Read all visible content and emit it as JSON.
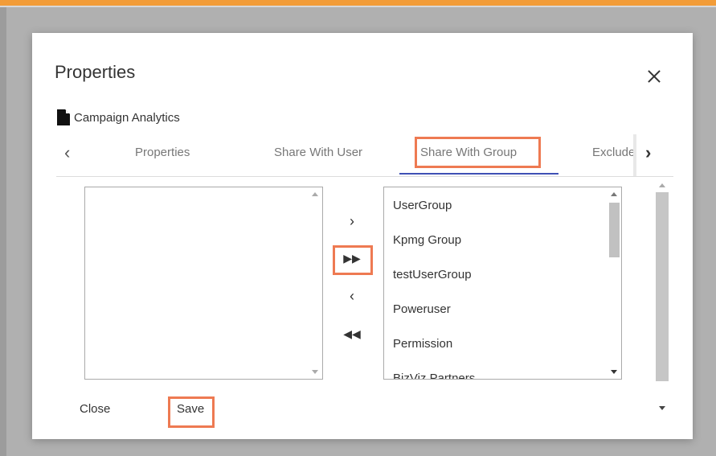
{
  "dialog": {
    "title": "Properties",
    "file_name": "Campaign Analytics"
  },
  "tabs": {
    "items": [
      {
        "label": "Properties"
      },
      {
        "label": "Share With User"
      },
      {
        "label": "Share With Group"
      },
      {
        "label": "Exclude"
      }
    ],
    "active": "Share With Group"
  },
  "available_groups": {
    "items": [
      {
        "label": "UserGroup"
      },
      {
        "label": "Kpmg Group"
      },
      {
        "label": "testUserGroup"
      },
      {
        "label": "Poweruser"
      },
      {
        "label": "Permission"
      },
      {
        "label": "BizViz Partners"
      }
    ]
  },
  "move_buttons": {
    "move_right": "›",
    "move_all_right": "▶▶",
    "move_left": "‹",
    "move_all_left": "◀◀"
  },
  "footer": {
    "close_label": "Close",
    "save_label": "Save"
  },
  "icons": {
    "close": "close-icon",
    "document": "document-icon",
    "tab_prev": "chevron-left-icon",
    "tab_next": "chevron-right-icon"
  },
  "colors": {
    "highlight": "#ee7a52",
    "active_tab_underline": "#3f51b5",
    "top_accent": "#f29c38"
  }
}
